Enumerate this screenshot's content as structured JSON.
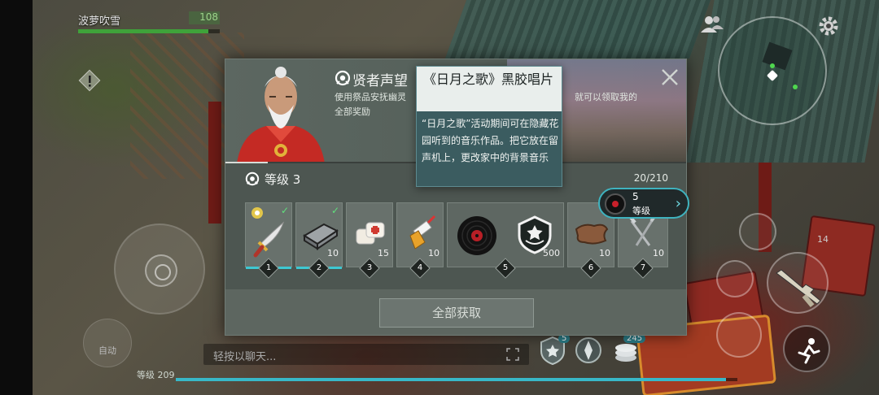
{
  "player": {
    "name": "波萝吹雪",
    "hp": "108",
    "hp_fraction": 0.92,
    "level_label": "等级 209",
    "xp_fraction": 0.98
  },
  "chat": {
    "placeholder": "轻按以聊天..."
  },
  "hud": {
    "ammo": "14",
    "badge_1": "5",
    "badge_3": "245",
    "auto_label": "自动"
  },
  "dialog": {
    "title": "贤者声望",
    "description": "使用祭品安抚幽灵，获得声望。提升声望，就可以领取我的全部奖励",
    "description_visible_start": "使用祭品安抚幽灵",
    "description_visible_line2": "全部奖励",
    "description_visible_tail": "就可以领取我的",
    "level": "等级 3",
    "progress": "20/210",
    "claim_all_label": "全部获取",
    "next_chip": {
      "number": "5",
      "label": "等级"
    },
    "rewards": [
      {
        "tier": "1",
        "icon": "dagger-icon",
        "quantity": "",
        "claimed": true
      },
      {
        "tier": "2",
        "icon": "metal-ingot-icon",
        "quantity": "10",
        "claimed": true
      },
      {
        "tier": "3",
        "icon": "bandage-icon",
        "quantity": "15",
        "claimed": false
      },
      {
        "tier": "4",
        "icon": "glue-bottle-icon",
        "quantity": "10",
        "claimed": false
      },
      {
        "tier": "5",
        "icon": "vinyl-record-icon",
        "icon_2": "prestige-badge-icon",
        "quantity": "500",
        "claimed": false
      },
      {
        "tier": "6",
        "icon": "leather-icon",
        "quantity": "10",
        "claimed": false
      },
      {
        "tier": "7",
        "icon": "nails-icon",
        "quantity": "10",
        "claimed": false
      }
    ],
    "check_mark": "✓"
  },
  "tooltip": {
    "title": "《日月之歌》黑胶唱片",
    "body": "“日月之歌”活动期间可在隐藏花园听到的音乐作品。把它放在留声机上，更改家中的背景音乐"
  },
  "colors": {
    "accent": "#3ec8d2",
    "panel": "#4d5651",
    "tooltip": "#3b5c60",
    "hp": "#3fa23a"
  }
}
